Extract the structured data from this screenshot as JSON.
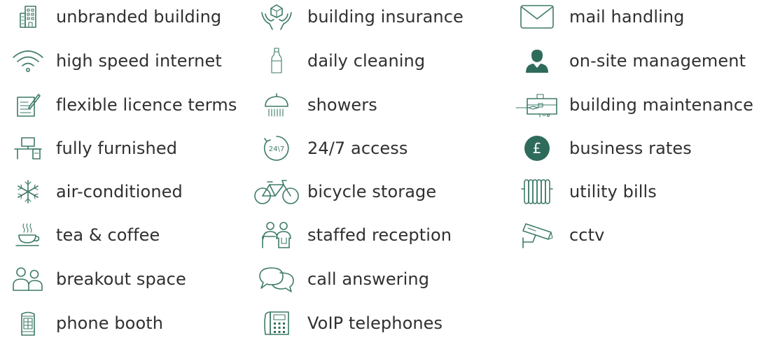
{
  "amenities": {
    "col1": [
      {
        "label": "unbranded building",
        "icon": "building-icon"
      },
      {
        "label": "high speed internet",
        "icon": "wifi-icon"
      },
      {
        "label": "flexible licence terms",
        "icon": "contract-icon"
      },
      {
        "label": "fully furnished",
        "icon": "desk-icon"
      },
      {
        "label": "air-conditioned",
        "icon": "snowflake-icon"
      },
      {
        "label": "tea & coffee",
        "icon": "coffee-cup-icon"
      },
      {
        "label": "breakout space",
        "icon": "people-icon"
      },
      {
        "label": "phone booth",
        "icon": "phone-booth-icon"
      }
    ],
    "col2": [
      {
        "label": "building insurance",
        "icon": "insurance-hands-icon"
      },
      {
        "label": "daily cleaning",
        "icon": "cleaning-bottle-icon"
      },
      {
        "label": "showers",
        "icon": "shower-icon"
      },
      {
        "label": "24/7 access",
        "icon": "clock-24-7-icon"
      },
      {
        "label": "bicycle storage",
        "icon": "bicycle-icon"
      },
      {
        "label": "staffed reception",
        "icon": "reception-icon"
      },
      {
        "label": "call answering",
        "icon": "speech-bubbles-icon"
      },
      {
        "label": "VoIP telephones",
        "icon": "desk-phone-icon"
      }
    ],
    "col3": [
      {
        "label": "mail handling",
        "icon": "envelope-icon"
      },
      {
        "label": "on-site management",
        "icon": "manager-icon"
      },
      {
        "label": "building maintenance",
        "icon": "toolbox-icon"
      },
      {
        "label": "business rates",
        "icon": "pound-coin-icon"
      },
      {
        "label": "utility bills",
        "icon": "radiator-icon"
      },
      {
        "label": "cctv",
        "icon": "cctv-camera-icon"
      }
    ]
  },
  "colors": {
    "icon": "#3e7a69",
    "icon_fill": "#2f6b5b",
    "text": "#303030",
    "background": "#ffffff"
  }
}
